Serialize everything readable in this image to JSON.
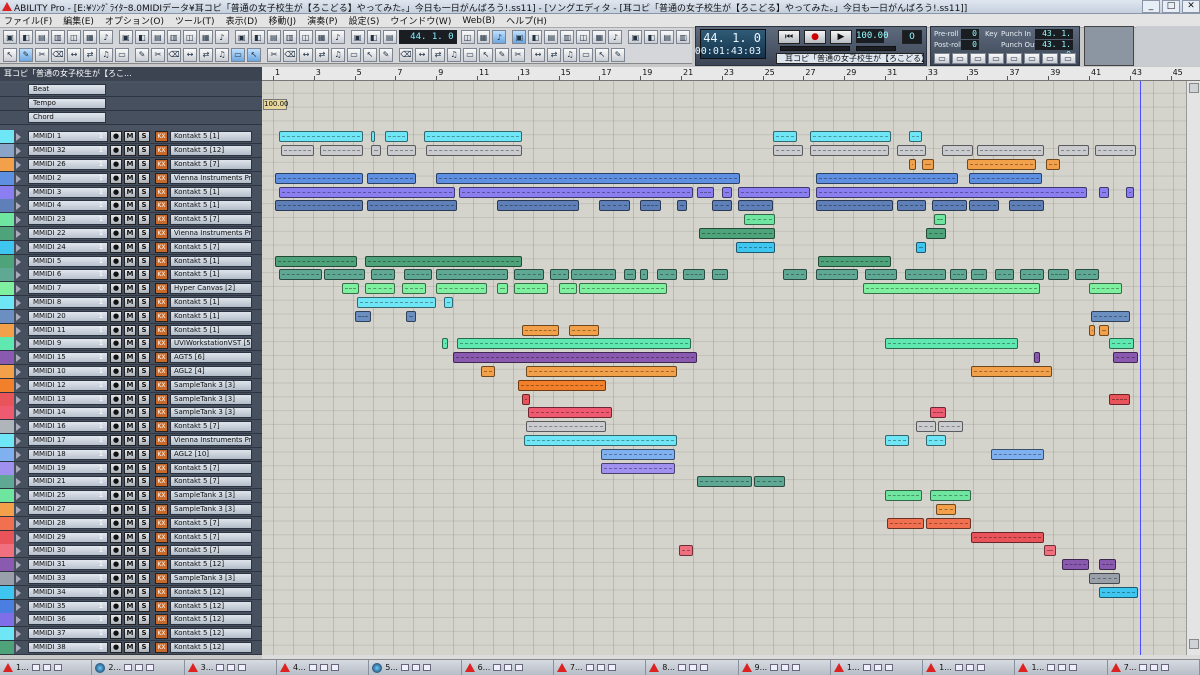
{
  "window": {
    "title": "ABILITY Pro - [E:¥ｿﾝｸﾞﾗｲﾀｰ8.0MIDIデータ¥耳コピ「普通の女子校生が【ろこどる】やってみた。」今日も一日がんばろう!.ss11] - [ソングエディタ - [耳コピ「普通の女子校生が【ろこどる】やってみた。」今日も一日がんばろう!.ss11]]"
  },
  "menu": [
    "ファイル(F)",
    "編集(E)",
    "オプション(O)",
    "ツール(T)",
    "表示(D)",
    "移動(J)",
    "演奏(P)",
    "設定(S)",
    "ウインドウ(W)",
    "Web(B)",
    "ヘルプ(H)"
  ],
  "toolbar": {
    "position": "44.  1.   0"
  },
  "transport": {
    "measure": "44.   1.   0",
    "time": "00:01:43:03",
    "tempo": "100.00",
    "key_shift": "0",
    "song_name": "耳コピ「普通の女子校生が【ろこどる】",
    "preroll_label": "Pre-roll",
    "postroll_label": "Post-roll",
    "preroll": "0",
    "postroll": "0",
    "key_label": "Key",
    "punch_in_label": "Punch In",
    "punch_out_label": "Punch Out",
    "punch_in": "43. 1. 0",
    "punch_out": "43. 1. 0"
  },
  "track_header": "耳コピ「普通の女子校生が【ろこ...",
  "global_tracks": [
    "Beat",
    "Tempo",
    "Chord"
  ],
  "tempo_value": "100.00",
  "ruler": [
    "1",
    "3",
    "5",
    "7",
    "9",
    "11",
    "13",
    "15",
    "17",
    "19",
    "21",
    "23",
    "25",
    "27",
    "29",
    "31",
    "33",
    "35",
    "37",
    "39",
    "41",
    "43",
    "45"
  ],
  "colors": {
    "cyan": "#6fe6f5",
    "blue": "#6a9be0",
    "violet": "#9a7ee8",
    "steel": "#7898c0",
    "green": "#6fe6a0",
    "teal": "#5fa894",
    "orange": "#f2a04a",
    "purple": "#8a5ab0",
    "red": "#e9545a",
    "pink": "#f08aa8",
    "sky": "#7fb0f0",
    "gray": "#b0b4bb"
  },
  "tracks": [
    {
      "name": "MMIDI 1",
      "ch": "1",
      "device": "Kontakt 5 [1]",
      "color": "#6fe6f5"
    },
    {
      "name": "MMIDI 32",
      "ch": "1",
      "device": "Kontakt 5 [12]",
      "color": "#8aa4c8"
    },
    {
      "name": "MMIDI 26",
      "ch": "1",
      "device": "Kontakt 5 [7]",
      "color": "#f2a04a"
    },
    {
      "name": "MMIDI 2",
      "ch": "1",
      "device": "Vienna Instruments Pro...",
      "color": "#5f8fe0"
    },
    {
      "name": "MMIDI 3",
      "ch": "1",
      "device": "Kontakt 5 [1]",
      "color": "#8a7ef0"
    },
    {
      "name": "MMIDI 4",
      "ch": "1",
      "device": "Kontakt 5 [1]",
      "color": "#5f7fb8"
    },
    {
      "name": "MMIDI 23",
      "ch": "1",
      "device": "Kontakt 5 [7]",
      "color": "#6fe6a0"
    },
    {
      "name": "MMIDI 22",
      "ch": "1",
      "device": "Vienna Instruments Pro...",
      "color": "#4ea37a"
    },
    {
      "name": "MMIDI 24",
      "ch": "1",
      "device": "Kontakt 5 [7]",
      "color": "#3fc6f0"
    },
    {
      "name": "MMIDI 5",
      "ch": "1",
      "device": "Kontakt 5 [1]",
      "color": "#4ea37a"
    },
    {
      "name": "MMIDI 6",
      "ch": "1",
      "device": "Kontakt 5 [1]",
      "color": "#5fa894"
    },
    {
      "name": "MMIDI 7",
      "ch": "1",
      "device": "Hyper Canvas [2]",
      "color": "#7ef0a0"
    },
    {
      "name": "MMIDI 8",
      "ch": "1",
      "device": "Kontakt 5 [1]",
      "color": "#6fe6f5"
    },
    {
      "name": "MMIDI 20",
      "ch": "1",
      "device": "Kontakt 5 [1]",
      "color": "#6a8fc0"
    },
    {
      "name": "MMIDI 11",
      "ch": "1",
      "device": "Kontakt 5 [1]",
      "color": "#f2a04a"
    },
    {
      "name": "MMIDI 9",
      "ch": "1",
      "device": "UVIWorkstationVST [5]",
      "color": "#5fe8b0"
    },
    {
      "name": "MMIDI 15",
      "ch": "1",
      "device": "AGT5 [6]",
      "color": "#8a5ab0"
    },
    {
      "name": "MMIDI 10",
      "ch": "1",
      "device": "AGL2 [4]",
      "color": "#f2a04a"
    },
    {
      "name": "MMIDI 12",
      "ch": "1",
      "device": "SampleTank 3 [3]",
      "color": "#f2802a"
    },
    {
      "name": "MMIDI 13",
      "ch": "1",
      "device": "SampleTank 3 [3]",
      "color": "#e9545a"
    },
    {
      "name": "MMIDI 14",
      "ch": "1",
      "device": "SampleTank 3 [3]",
      "color": "#f05a70"
    },
    {
      "name": "MMIDI 16",
      "ch": "1",
      "device": "Kontakt 5 [7]",
      "color": "#b0b4bb"
    },
    {
      "name": "MMIDI 17",
      "ch": "1",
      "device": "Vienna Instruments Pro...",
      "color": "#6fe6f5"
    },
    {
      "name": "MMIDI 18",
      "ch": "1",
      "device": "AGL2 [10]",
      "color": "#7fb0f0"
    },
    {
      "name": "MMIDI 19",
      "ch": "1",
      "device": "Kontakt 5 [7]",
      "color": "#a090f0"
    },
    {
      "name": "MMIDI 21",
      "ch": "1",
      "device": "Kontakt 5 [7]",
      "color": "#5fa894"
    },
    {
      "name": "MMIDI 25",
      "ch": "1",
      "device": "SampleTank 3 [3]",
      "color": "#6fe6a0"
    },
    {
      "name": "MMIDI 27",
      "ch": "1",
      "device": "SampleTank 3 [3]",
      "color": "#f2a04a"
    },
    {
      "name": "MMIDI 28",
      "ch": "1",
      "device": "Kontakt 5 [7]",
      "color": "#f07050"
    },
    {
      "name": "MMIDI 29",
      "ch": "1",
      "device": "Kontakt 5 [7]",
      "color": "#e9545a"
    },
    {
      "name": "MMIDI 30",
      "ch": "1",
      "device": "Kontakt 5 [7]",
      "color": "#f07080"
    },
    {
      "name": "MMIDI 31",
      "ch": "1",
      "device": "Kontakt 5 [12]",
      "color": "#8a5ab0"
    },
    {
      "name": "MMIDI 33",
      "ch": "1",
      "device": "SampleTank 3 [3]",
      "color": "#9aa0aa"
    },
    {
      "name": "MMIDI 34",
      "ch": "1",
      "device": "Kontakt 5 [12]",
      "color": "#3fc6f0"
    },
    {
      "name": "MMIDI 35",
      "ch": "1",
      "device": "Kontakt 5 [12]",
      "color": "#4a7ee0"
    },
    {
      "name": "MMIDI 36",
      "ch": "1",
      "device": "Kontakt 5 [12]",
      "color": "#7e6ee8"
    },
    {
      "name": "MMIDI 37",
      "ch": "1",
      "device": "Kontakt 5 [12]",
      "color": "#6fe6f5"
    },
    {
      "name": "MMIDI 38",
      "ch": "1",
      "device": "Kontakt 5 [12]",
      "color": "#4ea37a"
    }
  ],
  "clips": [
    {
      "track": 0,
      "s": 1.3,
      "e": 5.4,
      "c": "#6fe6f5"
    },
    {
      "track": 0,
      "s": 5.8,
      "e": 6.0,
      "c": "#6fe6f5"
    },
    {
      "track": 0,
      "s": 6.5,
      "e": 7.6,
      "c": "#6fe6f5"
    },
    {
      "track": 0,
      "s": 8.4,
      "e": 13.2,
      "c": "#6fe6f5"
    },
    {
      "track": 0,
      "s": 25.5,
      "e": 26.7,
      "c": "#6fe6f5"
    },
    {
      "track": 0,
      "s": 27.3,
      "e": 31.3,
      "c": "#6fe6f5"
    },
    {
      "track": 0,
      "s": 32.2,
      "e": 32.8,
      "c": "#6fe6f5"
    },
    {
      "track": 1,
      "s": 1.4,
      "e": 3.0,
      "c": "#c9cbcf"
    },
    {
      "track": 1,
      "s": 3.3,
      "e": 5.4,
      "c": "#c9cbcf"
    },
    {
      "track": 1,
      "s": 5.8,
      "e": 6.3,
      "c": "#c9cbcf"
    },
    {
      "track": 1,
      "s": 6.6,
      "e": 8.0,
      "c": "#c9cbcf"
    },
    {
      "track": 1,
      "s": 8.5,
      "e": 13.2,
      "c": "#c9cbcf"
    },
    {
      "track": 1,
      "s": 25.5,
      "e": 27.0,
      "c": "#c9cbcf"
    },
    {
      "track": 1,
      "s": 27.3,
      "e": 31.2,
      "c": "#c9cbcf"
    },
    {
      "track": 1,
      "s": 31.6,
      "e": 33.0,
      "c": "#c9cbcf"
    },
    {
      "track": 1,
      "s": 33.8,
      "e": 35.3,
      "c": "#c9cbcf"
    },
    {
      "track": 1,
      "s": 35.5,
      "e": 38.8,
      "c": "#c9cbcf"
    },
    {
      "track": 1,
      "s": 39.5,
      "e": 41.0,
      "c": "#c9cbcf"
    },
    {
      "track": 1,
      "s": 41.3,
      "e": 43.3,
      "c": "#c9cbcf"
    },
    {
      "track": 2,
      "s": 32.2,
      "e": 32.5,
      "c": "#f2a04a"
    },
    {
      "track": 2,
      "s": 32.8,
      "e": 33.4,
      "c": "#f2a04a"
    },
    {
      "track": 2,
      "s": 35.0,
      "e": 38.4,
      "c": "#f2a04a"
    },
    {
      "track": 2,
      "s": 38.9,
      "e": 39.6,
      "c": "#f2a04a"
    },
    {
      "track": 3,
      "s": 1.1,
      "e": 5.4,
      "c": "#5f8fe0"
    },
    {
      "track": 3,
      "s": 5.6,
      "e": 8.0,
      "c": "#5f8fe0"
    },
    {
      "track": 3,
      "s": 9.0,
      "e": 23.9,
      "c": "#5f8fe0"
    },
    {
      "track": 3,
      "s": 27.6,
      "e": 34.6,
      "c": "#5f8fe0"
    },
    {
      "track": 3,
      "s": 35.1,
      "e": 38.7,
      "c": "#5f8fe0"
    },
    {
      "track": 4,
      "s": 1.3,
      "e": 9.9,
      "c": "#8a7ef0"
    },
    {
      "track": 4,
      "s": 10.1,
      "e": 21.6,
      "c": "#8a7ef0"
    },
    {
      "track": 4,
      "s": 21.8,
      "e": 22.6,
      "c": "#8a7ef0"
    },
    {
      "track": 4,
      "s": 23.0,
      "e": 23.5,
      "c": "#8a7ef0"
    },
    {
      "track": 4,
      "s": 23.8,
      "e": 27.3,
      "c": "#8a7ef0"
    },
    {
      "track": 4,
      "s": 27.6,
      "e": 40.9,
      "c": "#8a7ef0"
    },
    {
      "track": 4,
      "s": 41.5,
      "e": 42.0,
      "c": "#8a7ef0"
    },
    {
      "track": 4,
      "s": 42.8,
      "e": 43.2,
      "c": "#8a7ef0"
    },
    {
      "track": 5,
      "s": 1.1,
      "e": 5.4,
      "c": "#5f7fb8"
    },
    {
      "track": 5,
      "s": 5.6,
      "e": 10.0,
      "c": "#5f7fb8"
    },
    {
      "track": 5,
      "s": 12.0,
      "e": 16.0,
      "c": "#5f7fb8"
    },
    {
      "track": 5,
      "s": 17.0,
      "e": 18.5,
      "c": "#5f7fb8"
    },
    {
      "track": 5,
      "s": 19.0,
      "e": 20.0,
      "c": "#5f7fb8"
    },
    {
      "track": 5,
      "s": 20.8,
      "e": 21.3,
      "c": "#5f7fb8"
    },
    {
      "track": 5,
      "s": 22.5,
      "e": 23.5,
      "c": "#5f7fb8"
    },
    {
      "track": 5,
      "s": 23.8,
      "e": 25.5,
      "c": "#5f7fb8"
    },
    {
      "track": 5,
      "s": 27.6,
      "e": 31.4,
      "c": "#5f7fb8"
    },
    {
      "track": 5,
      "s": 31.6,
      "e": 33.0,
      "c": "#5f7fb8"
    },
    {
      "track": 5,
      "s": 33.3,
      "e": 35.0,
      "c": "#5f7fb8"
    },
    {
      "track": 5,
      "s": 35.1,
      "e": 36.6,
      "c": "#5f7fb8"
    },
    {
      "track": 5,
      "s": 37.1,
      "e": 38.8,
      "c": "#5f7fb8"
    },
    {
      "track": 6,
      "s": 24.1,
      "e": 25.6,
      "c": "#6fe6a0"
    },
    {
      "track": 6,
      "s": 33.4,
      "e": 34.0,
      "c": "#6fe6a0"
    },
    {
      "track": 7,
      "s": 21.9,
      "e": 25.6,
      "c": "#4ea37a"
    },
    {
      "track": 7,
      "s": 33.0,
      "e": 34.0,
      "c": "#4ea37a"
    },
    {
      "track": 8,
      "s": 23.7,
      "e": 25.6,
      "c": "#3fc6f0"
    },
    {
      "track": 8,
      "s": 32.5,
      "e": 33.0,
      "c": "#3fc6f0"
    },
    {
      "track": 9,
      "s": 1.1,
      "e": 5.1,
      "c": "#4ea37a"
    },
    {
      "track": 9,
      "s": 5.5,
      "e": 13.2,
      "c": "#4ea37a"
    },
    {
      "track": 9,
      "s": 27.7,
      "e": 31.3,
      "c": "#4ea37a"
    },
    {
      "track": 10,
      "s": 1.3,
      "e": 3.4,
      "c": "#5fa894"
    },
    {
      "track": 10,
      "s": 3.5,
      "e": 5.5,
      "c": "#5fa894"
    },
    {
      "track": 10,
      "s": 5.8,
      "e": 7.0,
      "c": "#5fa894"
    },
    {
      "track": 10,
      "s": 7.4,
      "e": 8.8,
      "c": "#5fa894"
    },
    {
      "track": 10,
      "s": 9.0,
      "e": 12.5,
      "c": "#5fa894"
    },
    {
      "track": 10,
      "s": 12.8,
      "e": 14.3,
      "c": "#5fa894"
    },
    {
      "track": 10,
      "s": 14.6,
      "e": 15.5,
      "c": "#5fa894"
    },
    {
      "track": 10,
      "s": 15.6,
      "e": 17.8,
      "c": "#5fa894"
    },
    {
      "track": 10,
      "s": 18.2,
      "e": 18.8,
      "c": "#5fa894"
    },
    {
      "track": 10,
      "s": 19.0,
      "e": 19.4,
      "c": "#5fa894"
    },
    {
      "track": 10,
      "s": 19.8,
      "e": 20.8,
      "c": "#5fa894"
    },
    {
      "track": 10,
      "s": 21.1,
      "e": 22.2,
      "c": "#5fa894"
    },
    {
      "track": 10,
      "s": 22.5,
      "e": 23.3,
      "c": "#5fa894"
    },
    {
      "track": 10,
      "s": 26.0,
      "e": 27.2,
      "c": "#5fa894"
    },
    {
      "track": 10,
      "s": 27.6,
      "e": 29.7,
      "c": "#5fa894"
    },
    {
      "track": 10,
      "s": 30.0,
      "e": 31.6,
      "c": "#5fa894"
    },
    {
      "track": 10,
      "s": 32.0,
      "e": 34.0,
      "c": "#5fa894"
    },
    {
      "track": 10,
      "s": 34.2,
      "e": 35.0,
      "c": "#5fa894"
    },
    {
      "track": 10,
      "s": 35.2,
      "e": 36.0,
      "c": "#5fa894"
    },
    {
      "track": 10,
      "s": 36.4,
      "e": 37.3,
      "c": "#5fa894"
    },
    {
      "track": 10,
      "s": 37.6,
      "e": 38.8,
      "c": "#5fa894"
    },
    {
      "track": 10,
      "s": 39.0,
      "e": 40.0,
      "c": "#5fa894"
    },
    {
      "track": 10,
      "s": 40.3,
      "e": 41.5,
      "c": "#5fa894"
    },
    {
      "track": 11,
      "s": 4.4,
      "e": 5.2,
      "c": "#7ef0a0"
    },
    {
      "track": 11,
      "s": 5.5,
      "e": 7.0,
      "c": "#7ef0a0"
    },
    {
      "track": 11,
      "s": 7.3,
      "e": 8.5,
      "c": "#7ef0a0"
    },
    {
      "track": 11,
      "s": 9.0,
      "e": 11.5,
      "c": "#7ef0a0"
    },
    {
      "track": 11,
      "s": 12.0,
      "e": 12.5,
      "c": "#7ef0a0"
    },
    {
      "track": 11,
      "s": 12.8,
      "e": 14.5,
      "c": "#7ef0a0"
    },
    {
      "track": 11,
      "s": 15.0,
      "e": 15.9,
      "c": "#7ef0a0"
    },
    {
      "track": 11,
      "s": 16.0,
      "e": 20.3,
      "c": "#7ef0a0"
    },
    {
      "track": 11,
      "s": 29.9,
      "e": 38.6,
      "c": "#7ef0a0"
    },
    {
      "track": 11,
      "s": 41.0,
      "e": 42.6,
      "c": "#7ef0a0"
    },
    {
      "track": 12,
      "s": 5.1,
      "e": 9.0,
      "c": "#6fe6f5"
    },
    {
      "track": 12,
      "s": 9.4,
      "e": 9.8,
      "c": "#6fe6f5"
    },
    {
      "track": 13,
      "s": 5.0,
      "e": 5.8,
      "c": "#6a8fc0"
    },
    {
      "track": 13,
      "s": 7.5,
      "e": 8.0,
      "c": "#6a8fc0"
    },
    {
      "track": 13,
      "s": 41.1,
      "e": 43.0,
      "c": "#6a8fc0"
    },
    {
      "track": 14,
      "s": 13.2,
      "e": 15.0,
      "c": "#f2a04a"
    },
    {
      "track": 14,
      "s": 15.5,
      "e": 17.0,
      "c": "#f2a04a"
    },
    {
      "track": 14,
      "s": 41.0,
      "e": 41.3,
      "c": "#f2a04a"
    },
    {
      "track": 14,
      "s": 41.5,
      "e": 42.0,
      "c": "#f2a04a"
    },
    {
      "track": 15,
      "s": 9.3,
      "e": 9.6,
      "c": "#5fe8b0"
    },
    {
      "track": 15,
      "s": 10.0,
      "e": 21.5,
      "c": "#5fe8b0"
    },
    {
      "track": 15,
      "s": 31.0,
      "e": 37.5,
      "c": "#5fe8b0"
    },
    {
      "track": 15,
      "s": 42.0,
      "e": 43.2,
      "c": "#5fe8b0"
    },
    {
      "track": 16,
      "s": 9.8,
      "e": 21.8,
      "c": "#8a5ab0"
    },
    {
      "track": 16,
      "s": 38.3,
      "e": 38.6,
      "c": "#8a5ab0"
    },
    {
      "track": 16,
      "s": 42.2,
      "e": 43.4,
      "c": "#8a5ab0"
    },
    {
      "track": 17,
      "s": 11.2,
      "e": 11.9,
      "c": "#f2a04a"
    },
    {
      "track": 17,
      "s": 13.4,
      "e": 20.8,
      "c": "#f2a04a"
    },
    {
      "track": 17,
      "s": 35.2,
      "e": 39.2,
      "c": "#f2a04a"
    },
    {
      "track": 18,
      "s": 13.0,
      "e": 17.3,
      "c": "#f2802a"
    },
    {
      "track": 19,
      "s": 13.2,
      "e": 13.6,
      "c": "#e9545a"
    },
    {
      "track": 19,
      "s": 42.0,
      "e": 43.0,
      "c": "#e9545a"
    },
    {
      "track": 20,
      "s": 13.5,
      "e": 17.6,
      "c": "#f05a70"
    },
    {
      "track": 20,
      "s": 33.2,
      "e": 34.0,
      "c": "#f05a70"
    },
    {
      "track": 21,
      "s": 13.4,
      "e": 17.3,
      "c": "#c9cbcf"
    },
    {
      "track": 21,
      "s": 32.5,
      "e": 33.5,
      "c": "#c9cbcf"
    },
    {
      "track": 21,
      "s": 33.6,
      "e": 34.8,
      "c": "#c9cbcf"
    },
    {
      "track": 22,
      "s": 13.3,
      "e": 20.8,
      "c": "#6fe6f5"
    },
    {
      "track": 22,
      "s": 31.0,
      "e": 32.2,
      "c": "#6fe6f5"
    },
    {
      "track": 22,
      "s": 33.0,
      "e": 34.0,
      "c": "#6fe6f5"
    },
    {
      "track": 23,
      "s": 17.1,
      "e": 20.7,
      "c": "#7fb0f0"
    },
    {
      "track": 23,
      "s": 36.2,
      "e": 38.8,
      "c": "#7fb0f0"
    },
    {
      "track": 24,
      "s": 17.1,
      "e": 20.7,
      "c": "#a090f0"
    },
    {
      "track": 25,
      "s": 21.8,
      "e": 24.5,
      "c": "#5fa894"
    },
    {
      "track": 25,
      "s": 24.6,
      "e": 26.1,
      "c": "#5fa894"
    },
    {
      "track": 26,
      "s": 31.0,
      "e": 32.8,
      "c": "#6fe6a0"
    },
    {
      "track": 26,
      "s": 33.2,
      "e": 35.2,
      "c": "#6fe6a0"
    },
    {
      "track": 27,
      "s": 33.5,
      "e": 34.5,
      "c": "#f2a04a"
    },
    {
      "track": 28,
      "s": 31.1,
      "e": 32.9,
      "c": "#f07050"
    },
    {
      "track": 28,
      "s": 33.0,
      "e": 35.2,
      "c": "#f07050"
    },
    {
      "track": 29,
      "s": 35.2,
      "e": 38.8,
      "c": "#e9545a"
    },
    {
      "track": 30,
      "s": 20.9,
      "e": 21.6,
      "c": "#f07080"
    },
    {
      "track": 30,
      "s": 38.8,
      "e": 39.4,
      "c": "#f07080"
    },
    {
      "track": 31,
      "s": 39.7,
      "e": 41.0,
      "c": "#8a5ab0"
    },
    {
      "track": 31,
      "s": 41.5,
      "e": 42.3,
      "c": "#8a5ab0"
    },
    {
      "track": 32,
      "s": 41.0,
      "e": 42.5,
      "c": "#9aa0aa"
    },
    {
      "track": 33,
      "s": 41.5,
      "e": 43.4,
      "c": "#3fc6f0"
    }
  ],
  "playhead_bar": 43.5,
  "taskbar": [
    "1...",
    "2...",
    "3...",
    "4...",
    "5...",
    "6...",
    "7...",
    "8...",
    "9...",
    "1...",
    "1...",
    "1...",
    "7..."
  ]
}
